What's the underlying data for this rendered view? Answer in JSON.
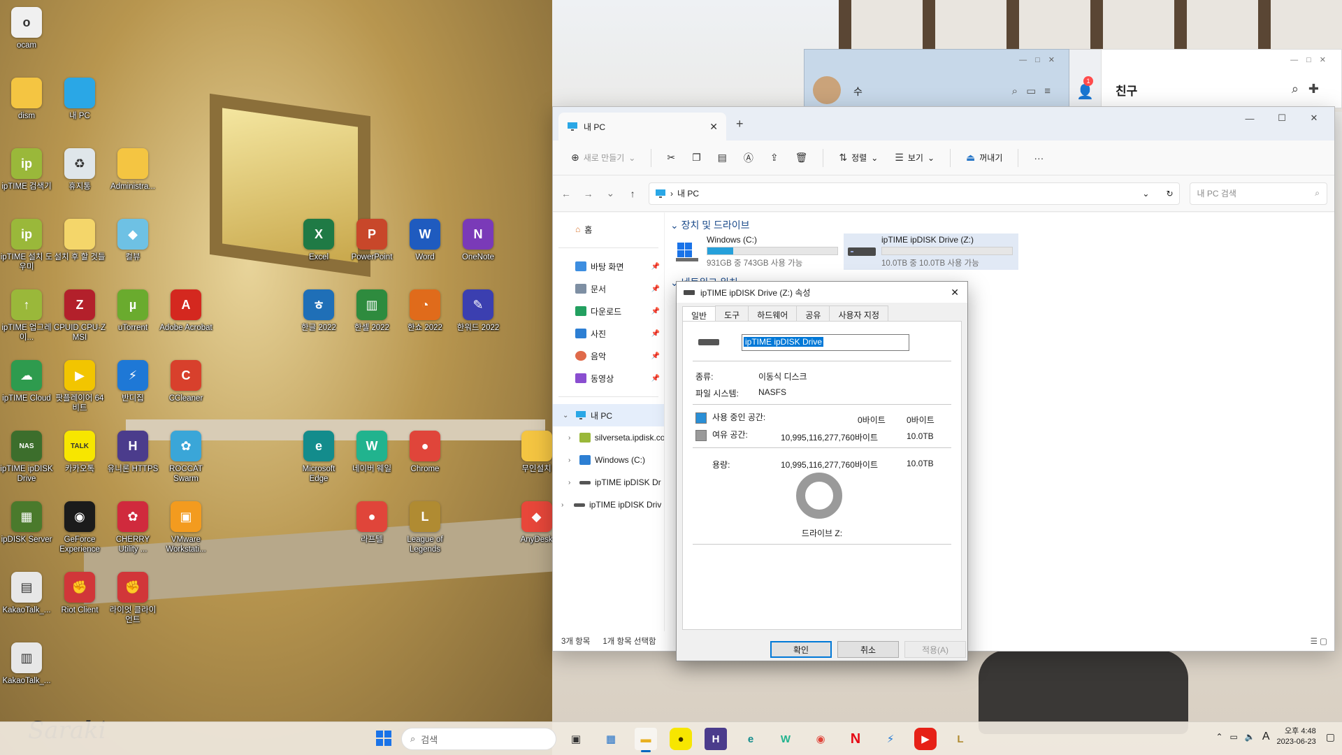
{
  "desktop_icons": [
    {
      "label": "ocam",
      "color": "#f0f0f0",
      "glyph": "o",
      "icon": "ocam-icon"
    },
    {
      "label": "dism",
      "color": "#f4c542",
      "glyph": "",
      "icon": "folder-icon"
    },
    {
      "label": "내 PC",
      "color": "#2aa7e6",
      "glyph": "",
      "icon": "monitor-icon"
    },
    {
      "label": "ipTIME 검색기",
      "color": "#9ab83a",
      "glyph": "ip",
      "icon": "iptime-search-icon"
    },
    {
      "label": "휴지통",
      "color": "#dfe6ea",
      "glyph": "♻",
      "icon": "recycle-bin-icon"
    },
    {
      "label": "Administra...",
      "color": "#f4c542",
      "glyph": "",
      "icon": "folder-icon"
    },
    {
      "label": "ipTIME 설치 도우미",
      "color": "#9ab83a",
      "glyph": "ip",
      "icon": "iptime-setup-icon"
    },
    {
      "label": "설치 후 할 것들",
      "color": "#f4d66a",
      "glyph": "",
      "icon": "shortcut-folder-icon"
    },
    {
      "label": "컬뷰",
      "color": "#6ec1e4",
      "glyph": "◆",
      "icon": "colorview-icon"
    },
    {
      "label": "ipTIME 업그레이...",
      "color": "#9ab83a",
      "glyph": "↑",
      "icon": "iptime-upgrade-icon"
    },
    {
      "label": "CPUID CPU-Z MSI",
      "color": "#b3202b",
      "glyph": "Z",
      "icon": "cpuz-icon"
    },
    {
      "label": "uTorrent",
      "color": "#6aab2e",
      "glyph": "µ",
      "icon": "utorrent-icon"
    },
    {
      "label": "Adobe Acrobat",
      "color": "#d4281f",
      "glyph": "A",
      "icon": "acrobat-icon"
    },
    {
      "label": "ipTIME Cloud",
      "color": "#2e9b4e",
      "glyph": "☁",
      "icon": "iptime-cloud-icon"
    },
    {
      "label": "팟플레이어 64 비트",
      "color": "#f2c500",
      "glyph": "▶",
      "icon": "potplayer-icon"
    },
    {
      "label": "반디집",
      "color": "#1e78d6",
      "glyph": "⚡",
      "icon": "bandizip-icon"
    },
    {
      "label": "CCleaner",
      "color": "#d8402c",
      "glyph": "C",
      "icon": "ccleaner-icon"
    },
    {
      "label": "ipTIME ipDISK Drive",
      "color": "#3c6e2c",
      "glyph": "NAS",
      "icon": "ipdisk-drive-icon"
    },
    {
      "label": "카카오톡",
      "color": "#f7e600",
      "glyph": "TALK",
      "icon": "kakaotalk-icon"
    },
    {
      "label": "유니론 HTTPS",
      "color": "#4b3c8c",
      "glyph": "H",
      "icon": "https-icon"
    },
    {
      "label": "ROCCAT Swarm",
      "color": "#3aa6d8",
      "glyph": "✿",
      "icon": "roccat-icon"
    },
    {
      "label": "ipDISK Server",
      "color": "#4a7a2c",
      "glyph": "▦",
      "icon": "ipdisk-server-icon"
    },
    {
      "label": "GeForce Experience",
      "color": "#1b1b1b",
      "glyph": "◉",
      "icon": "geforce-icon"
    },
    {
      "label": "CHERRY Utility ...",
      "color": "#d02a3d",
      "glyph": "✿",
      "icon": "cherry-icon"
    },
    {
      "label": "VMware Workstati...",
      "color": "#f39b1f",
      "glyph": "▣",
      "icon": "vmware-icon"
    },
    {
      "label": "KakaoTalk_...",
      "color": "#e7e7e7",
      "glyph": "▤",
      "icon": "kakaotalk-file-icon"
    },
    {
      "label": "Riot Client",
      "color": "#d13639",
      "glyph": "✊",
      "icon": "riot-client-icon"
    },
    {
      "label": "라이엇 클라이언트",
      "color": "#d13639",
      "glyph": "✊",
      "icon": "riot-client-kr-icon"
    },
    {
      "label": "KakaoTalk_...",
      "color": "#e7e7e7",
      "glyph": "▥",
      "icon": "kakaotalk-file2-icon"
    },
    {
      "label": "Excel",
      "color": "#1f7a45",
      "glyph": "X",
      "icon": "excel-icon"
    },
    {
      "label": "PowerPoint",
      "color": "#c8472a",
      "glyph": "P",
      "icon": "powerpoint-icon"
    },
    {
      "label": "Word",
      "color": "#1f5bbf",
      "glyph": "W",
      "icon": "word-icon"
    },
    {
      "label": "OneNote",
      "color": "#7a3ab8",
      "glyph": "N",
      "icon": "onenote-icon"
    },
    {
      "label": "한글 2022",
      "color": "#1f6fb7",
      "glyph": "ㅎ",
      "icon": "hangul-icon"
    },
    {
      "label": "한셀 2022",
      "color": "#2e8b3e",
      "glyph": "▥",
      "icon": "hancell-icon"
    },
    {
      "label": "한쇼 2022",
      "color": "#e06b1b",
      "glyph": "◔",
      "icon": "hanshow-icon"
    },
    {
      "label": "한워드 2022",
      "color": "#3b3fb0",
      "glyph": "✎",
      "icon": "hanword-icon"
    },
    {
      "label": "Microsoft Edge",
      "color": "#138c8c",
      "glyph": "e",
      "icon": "edge-icon"
    },
    {
      "label": "네이버 웨일",
      "color": "#21b38e",
      "glyph": "W",
      "icon": "whale-icon"
    },
    {
      "label": "Chrome",
      "color": "#e0453a",
      "glyph": "●",
      "icon": "chrome-icon"
    },
    {
      "label": "무인설치",
      "color": "#f4c542",
      "glyph": "",
      "icon": "folder-icon"
    },
    {
      "label": "라프텔",
      "color": "#e0453a",
      "glyph": "●",
      "icon": "chrome-app-icon"
    },
    {
      "label": "League of Legends",
      "color": "#b08b32",
      "glyph": "L",
      "icon": "league-of-legends-icon"
    },
    {
      "label": "AnyDesk",
      "color": "#e8473a",
      "glyph": "◆",
      "icon": "anydesk-icon"
    }
  ],
  "kakao": {
    "chat_name": "수",
    "friends_title": "친구",
    "badge": "1"
  },
  "explorer": {
    "tab_title": "내 PC",
    "toolbar": {
      "new": "새로 만들기",
      "sort": "정렬",
      "view": "보기",
      "eject": "꺼내기",
      "more": "···"
    },
    "address": "내 PC",
    "search_placeholder": "내 PC 검색",
    "nav": {
      "home": "홈",
      "desktop": "바탕 화면",
      "documents": "문서",
      "downloads": "다운로드",
      "pictures": "사진",
      "music": "음악",
      "videos": "동영상",
      "this_pc": "내 PC",
      "net1": "silverseta.ipdisk.co",
      "windows_c": "Windows (C:)",
      "ipdisk1": "ipTIME ipDISK Dr",
      "ipdisk2": "ipTIME ipDISK Driv"
    },
    "group_devices": "장치 및 드라이브",
    "group_network": "네트워크 위치",
    "drives": [
      {
        "name": "Windows (C:)",
        "free": "931GB 중 743GB 사용 가능",
        "used_fraction": 0.2
      },
      {
        "name": "ipTIME ipDISK Drive (Z:)",
        "free": "10.0TB 중 10.0TB 사용 가능",
        "used_fraction": 0.0
      }
    ],
    "status_items": "3개 항목",
    "status_selected": "1개 항목 선택함"
  },
  "props": {
    "title": "ipTIME ipDISK Drive (Z:) 속성",
    "tabs": [
      "일반",
      "도구",
      "하드웨어",
      "공유",
      "사용자 지정"
    ],
    "name_value": "ipTIME ipDISK Drive",
    "type_label": "종류:",
    "type_value": "이동식 디스크",
    "fs_label": "파일 시스템:",
    "fs_value": "NASFS",
    "used_label": "사용 중인 공간:",
    "used_bytes": "0바이트",
    "used_short": "0바이트",
    "free_label": "여유 공간:",
    "free_bytes": "10,995,116,277,760바이트",
    "free_short": "10.0TB",
    "capacity_label": "용량:",
    "capacity_bytes": "10,995,116,277,760바이트",
    "capacity_short": "10.0TB",
    "drive_label": "드라이브 Z:",
    "ok": "확인",
    "cancel": "취소",
    "apply": "적용(A)",
    "used_color": "#2a8fd6",
    "free_color": "#9a9a9a"
  },
  "taskbar": {
    "search": "검색",
    "time": "오후 4:48",
    "date": "2023-06-23",
    "ime": "A"
  }
}
